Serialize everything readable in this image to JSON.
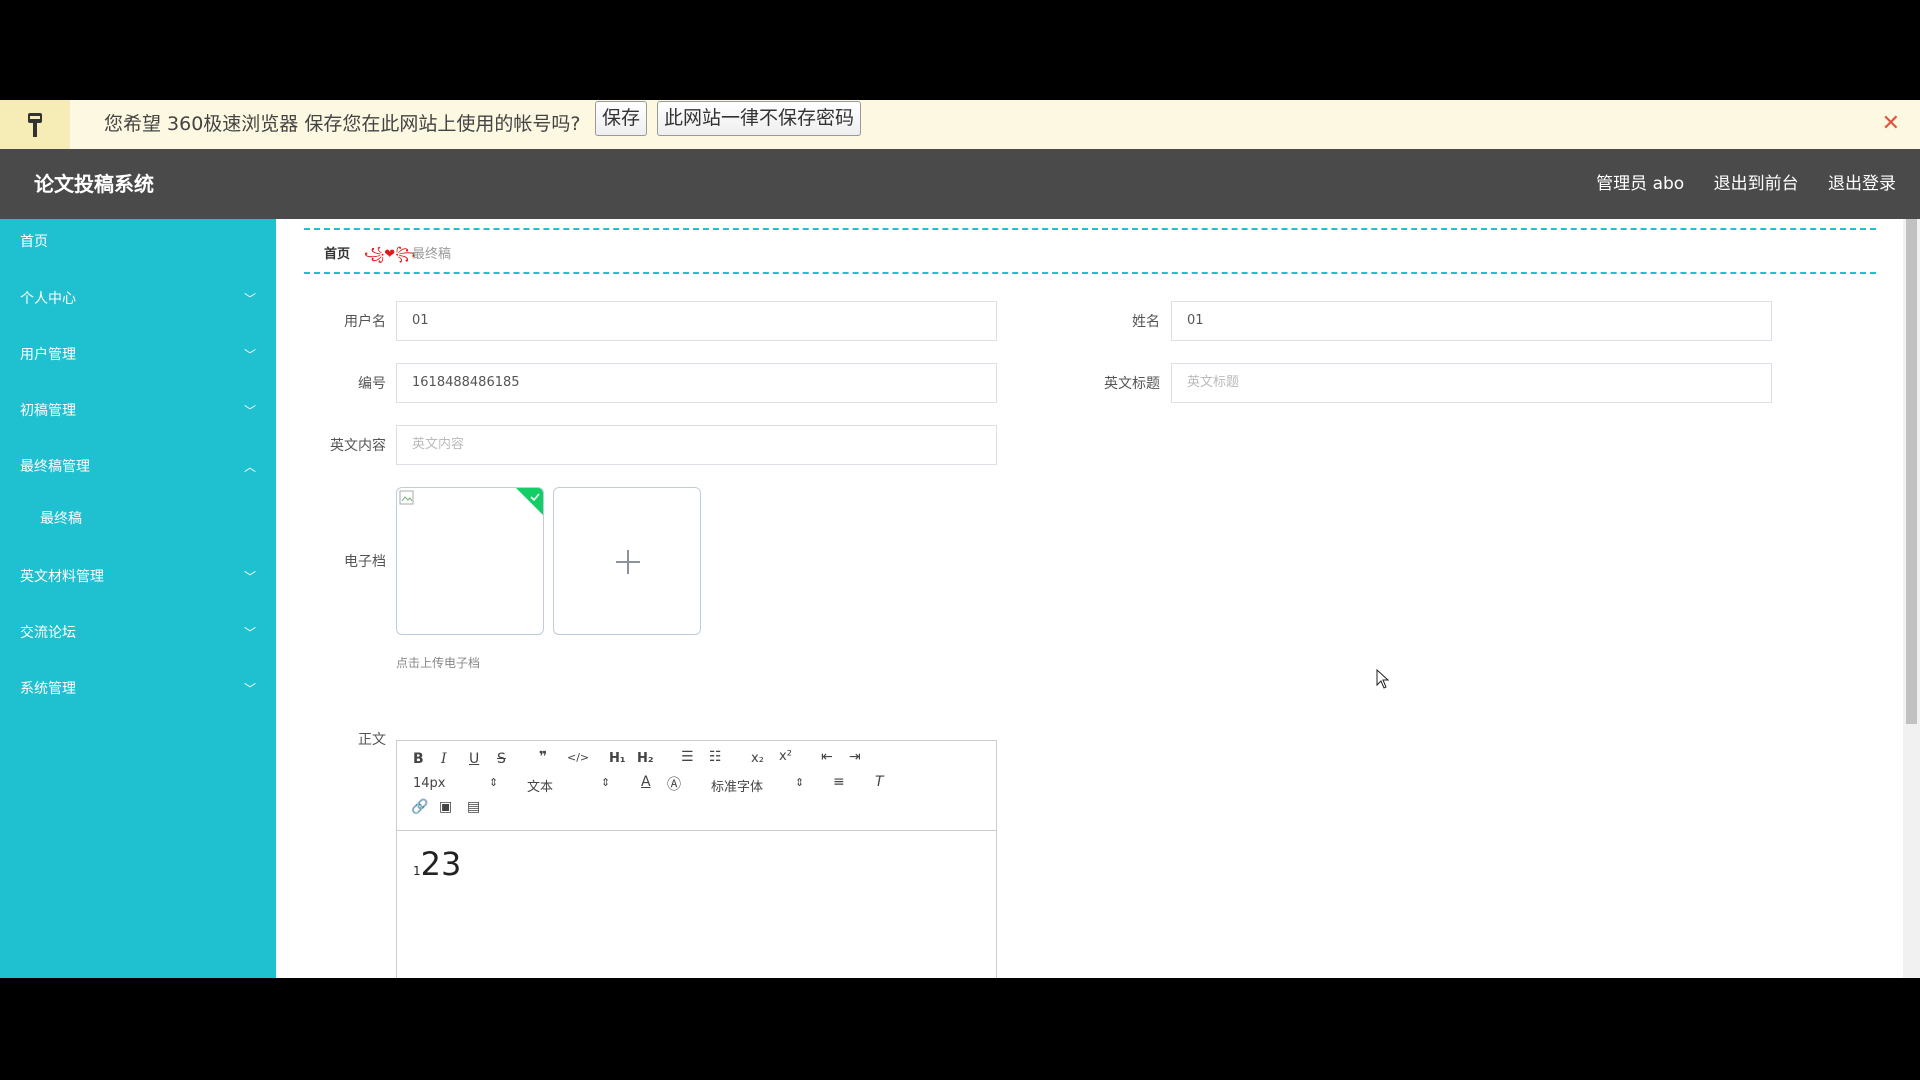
{
  "password_bar": {
    "message": "您希望 360极速浏览器 保存您在此网站上使用的帐号吗?",
    "save_button": "保存",
    "never_button": "此网站一律不保存密码",
    "close_symbol": "✕"
  },
  "header": {
    "title": "论文投稿系统",
    "user": "管理员 abo",
    "to_front": "退出到前台",
    "logout": "退出登录"
  },
  "sidebar": {
    "items": [
      {
        "label": "首页"
      },
      {
        "label": "个人中心"
      },
      {
        "label": "用户管理"
      },
      {
        "label": "初稿管理"
      },
      {
        "label": "最终稿管理"
      },
      {
        "label": "最终稿"
      },
      {
        "label": "英文材料管理"
      },
      {
        "label": "交流论坛"
      },
      {
        "label": "系统管理"
      }
    ]
  },
  "breadcrumb": {
    "home": "首页",
    "separator": "꧁❤꧂",
    "current": "最终稿"
  },
  "form": {
    "username_label": "用户名",
    "username_value": "01",
    "name_label": "姓名",
    "name_value": "01",
    "number_label": "编号",
    "number_value": "1618488486185",
    "en_title_label": "英文标题",
    "en_title_placeholder": "英文标题",
    "en_content_label": "英文内容",
    "en_content_placeholder": "英文内容",
    "efile_label": "电子档",
    "upload_hint": "点击上传电子档",
    "body_label": "正文"
  },
  "editor": {
    "font_size": "14px",
    "block_type": "文本",
    "font_family": "标准字体",
    "content_small": "1",
    "content_big": "23"
  }
}
